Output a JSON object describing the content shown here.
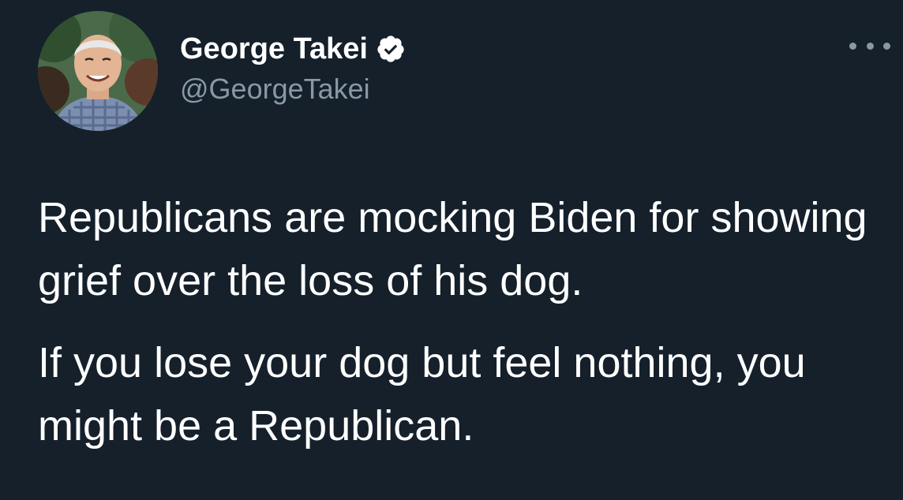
{
  "tweet": {
    "author": {
      "display_name": "George Takei",
      "handle": "@GeorgeTakei",
      "verified": true,
      "avatar_icon": "profile-photo"
    },
    "more_icon": "ellipsis-icon",
    "paragraphs": [
      "Republicans are mocking Biden for showing grief over the loss of his dog.",
      "If you lose your dog but feel nothing, you might be a Republican."
    ]
  },
  "colors": {
    "background": "#15202b",
    "text": "#ffffff",
    "secondary_text": "#8899a6",
    "verified_badge": "#ffffff"
  }
}
